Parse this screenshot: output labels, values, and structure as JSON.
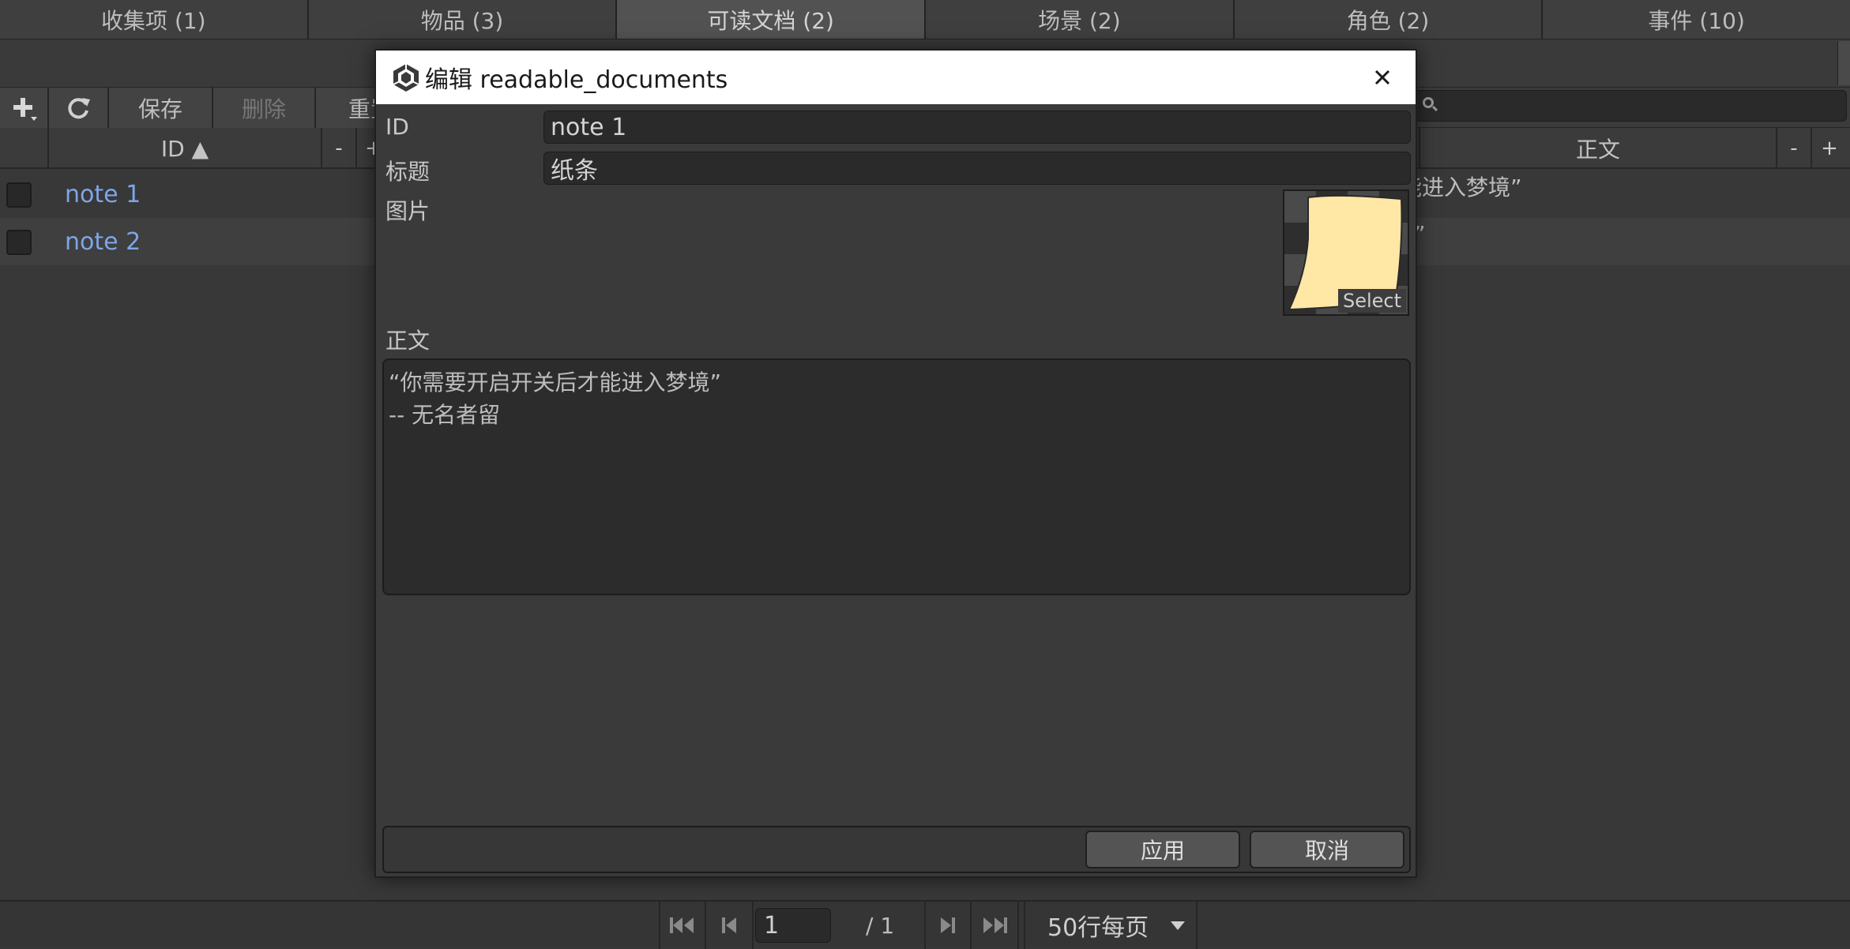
{
  "tabs": [
    {
      "label": "收集项 (1)"
    },
    {
      "label": "物品 (3)"
    },
    {
      "label": "可读文档 (2)"
    },
    {
      "label": "场景 (2)"
    },
    {
      "label": "角色 (2)"
    },
    {
      "label": "事件 (10)"
    }
  ],
  "toolbar": {
    "add_icon": "plus-icon",
    "refresh_icon": "refresh-icon",
    "save_label": "保存",
    "delete_label": "删除",
    "reset_label": "重置"
  },
  "table": {
    "columns": [
      {
        "label": "ID ▲",
        "minus": "-",
        "plus": "+"
      },
      {
        "label": "正文",
        "minus": "-",
        "plus": "+"
      }
    ],
    "rows": [
      {
        "id": "note 1",
        "body_visible": "能进入梦境”"
      },
      {
        "id": "note 2",
        "body_visible": "”"
      }
    ]
  },
  "pager": {
    "page": "1",
    "total": "/ 1",
    "page_size": "50行每页"
  },
  "dialog": {
    "title": "编辑 readable_documents",
    "fields": {
      "id_label": "ID",
      "id_value": "note 1",
      "title_label": "标题",
      "title_value": "纸条",
      "image_label": "图片",
      "image_select": "Select",
      "body_label": "正文",
      "body_value": "“你需要开启开关后才能进入梦境”\n-- 无名者留"
    },
    "apply_label": "应用",
    "cancel_label": "取消"
  },
  "colors": {
    "background": "#383838",
    "link_blue": "#7da6e6",
    "active_tab": "#525252",
    "note_paper": "#ffe7a6"
  }
}
